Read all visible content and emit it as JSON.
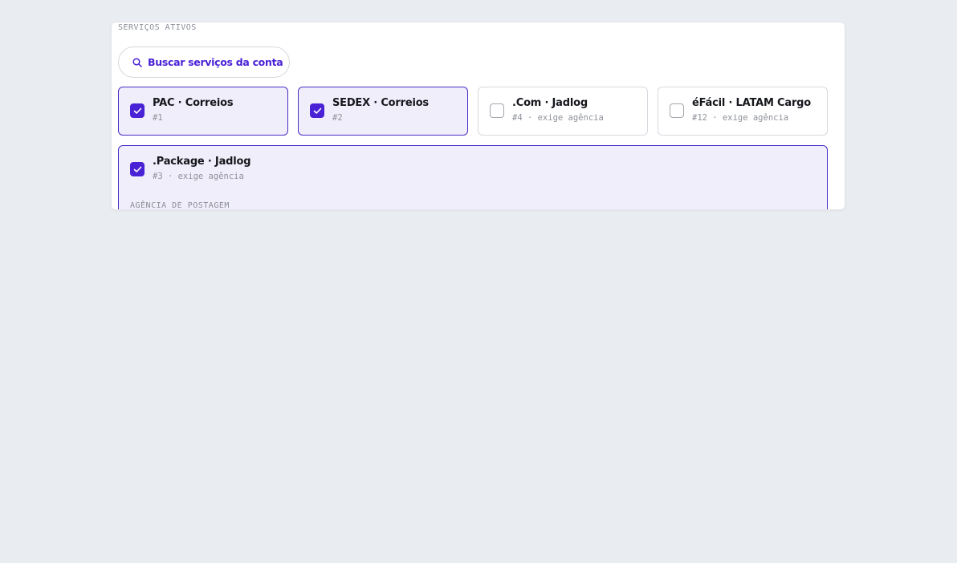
{
  "section": {
    "title": "SERVIÇOS ATIVOS"
  },
  "search": {
    "label": "Buscar serviços da conta",
    "icon": "search-icon"
  },
  "colors": {
    "accent": "#4a22d6",
    "checked_border": "#4b2bc4",
    "checked_bg": "#f1eefb",
    "page_bg": "#e9ecf0"
  },
  "services": [
    {
      "name": "PAC · Correios",
      "meta": "#1",
      "checked": true
    },
    {
      "name": "SEDEX · Correios",
      "meta": "#2",
      "checked": true
    },
    {
      "name": ".Com · Jadlog",
      "meta": "#4 · exige agência",
      "checked": false
    },
    {
      "name": "éFácil · LATAM Cargo",
      "meta": "#12 · exige agência",
      "checked": false
    },
    {
      "name": ".Package · Jadlog",
      "meta": "#3 · exige agência",
      "checked": true,
      "subsection": "AGÊNCIA DE POSTAGEM"
    }
  ]
}
